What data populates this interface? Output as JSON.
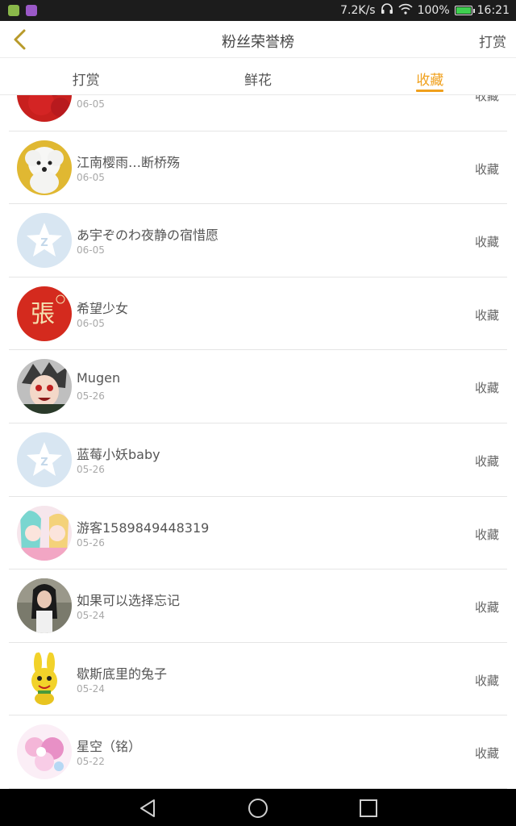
{
  "status_bar": {
    "speed": "7.2K/s",
    "battery": "100%",
    "time": "16:21",
    "battery_level": 1.0
  },
  "header": {
    "title": "粉丝荣誉榜",
    "right_action": "打赏"
  },
  "tabs": [
    {
      "label": "打赏",
      "active": false
    },
    {
      "label": "鲜花",
      "active": false
    },
    {
      "label": "收藏",
      "active": true
    }
  ],
  "list": [
    {
      "name": "",
      "date": "06-05",
      "tag": "收藏",
      "avatar": "red-avatar"
    },
    {
      "name": "江南樱雨…断桥殇",
      "date": "06-05",
      "tag": "收藏",
      "avatar": "white-dog-avatar"
    },
    {
      "name": "あ宇ぞのわ夜静の宿惜愿",
      "date": "06-05",
      "tag": "收藏",
      "avatar": "default-qq-avatar"
    },
    {
      "name": "希望少女",
      "date": "06-05",
      "tag": "收藏",
      "avatar": "zhang-seal-avatar",
      "avatar_text": "張"
    },
    {
      "name": "Mugen",
      "date": "05-26",
      "tag": "收藏",
      "avatar": "anime-boy-avatar"
    },
    {
      "name": "蓝莓小妖baby",
      "date": "05-26",
      "tag": "收藏",
      "avatar": "default-qq-avatar"
    },
    {
      "name": "游客1589849448319",
      "date": "05-26",
      "tag": "收藏",
      "avatar": "anime-girls-avatar"
    },
    {
      "name": "如果可以选择忘记",
      "date": "05-24",
      "tag": "收藏",
      "avatar": "girl-photo-avatar"
    },
    {
      "name": "歇斯底里的兔子",
      "date": "05-24",
      "tag": "收藏",
      "avatar": "yellow-rabbit-avatar"
    },
    {
      "name": "星空（铭）",
      "date": "05-22",
      "tag": "收藏",
      "avatar": "pink-flowers-avatar"
    }
  ],
  "colors": {
    "accent": "#f0a01c",
    "divider": "#e5e5e5",
    "status_bar": "#1c1c1c",
    "nav_bar": "#000000"
  }
}
